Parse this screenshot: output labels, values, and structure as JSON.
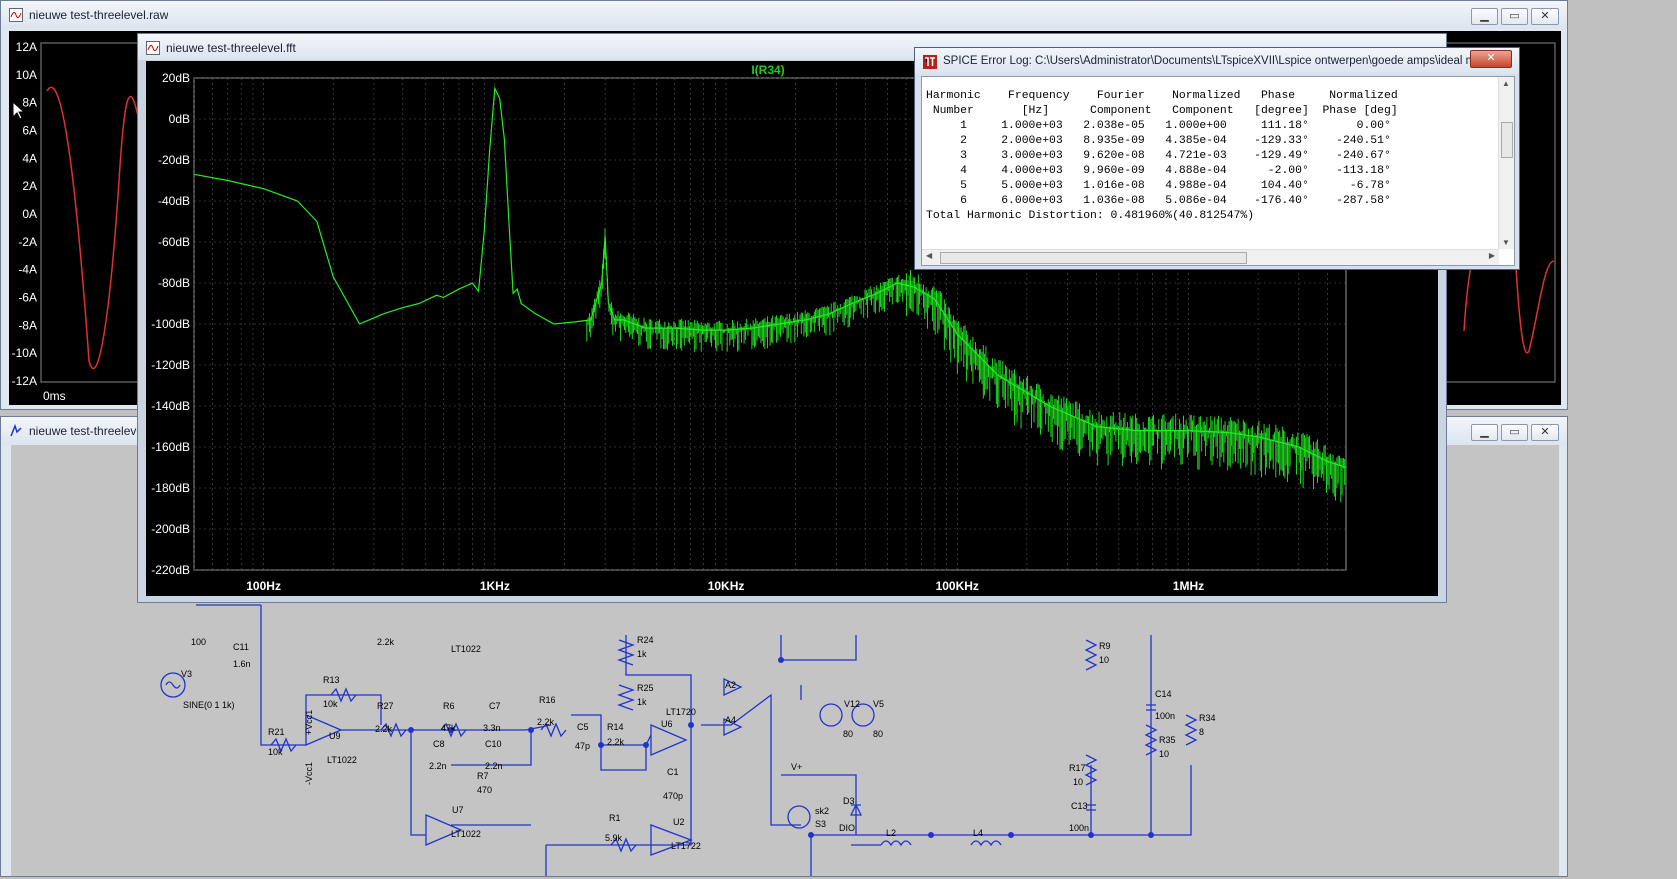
{
  "raw_window": {
    "title": "nieuwe test-threelevel.raw",
    "y_ticks": [
      "12A",
      "10A",
      "8A",
      "6A",
      "4A",
      "2A",
      "0A",
      "-2A",
      "-4A",
      "-6A",
      "-8A",
      "-10A",
      "-12A"
    ],
    "x_first_tick": "0ms",
    "trace_color": "#e03030"
  },
  "schematic_window": {
    "title": "nieuwe test-threelevel",
    "wire_color": "#2233cc",
    "labels": [
      {
        "name": "r-label",
        "t": "100"
      },
      {
        "name": "c11",
        "t": "C11"
      },
      {
        "name": "c11-val",
        "t": "1.6n"
      },
      {
        "name": "v3",
        "t": "V3"
      },
      {
        "name": "sine",
        "t": "SINE(0 1 1k)"
      },
      {
        "name": "r13",
        "t": "R13"
      },
      {
        "name": "r13-val",
        "t": "10k"
      },
      {
        "name": "r21",
        "t": "R21"
      },
      {
        "name": "r21-val",
        "t": "10k"
      },
      {
        "name": "u9",
        "t": "U9"
      },
      {
        "name": "lt1022-a",
        "t": "LT1022"
      },
      {
        "name": "vcc-a",
        "t": "+Vcc1"
      },
      {
        "name": "vcc-b",
        "t": "-Vcc1"
      },
      {
        "name": "r27",
        "t": "R27"
      },
      {
        "name": "r27-val",
        "t": "2.2k"
      },
      {
        "name": "r-22k-top",
        "t": "2.2k"
      },
      {
        "name": "lt1022-b",
        "t": "LT1022"
      },
      {
        "name": "r6",
        "t": "R6"
      },
      {
        "name": "r6-val",
        "t": "47k"
      },
      {
        "name": "c7",
        "t": "C7"
      },
      {
        "name": "c7-val",
        "t": "3.3n"
      },
      {
        "name": "c8",
        "t": "C8"
      },
      {
        "name": "c8-val",
        "t": "2.2n"
      },
      {
        "name": "c10",
        "t": "C10"
      },
      {
        "name": "c10-val",
        "t": "2.2n"
      },
      {
        "name": "r7",
        "t": "R7"
      },
      {
        "name": "r7-val",
        "t": "470"
      },
      {
        "name": "u7",
        "t": "U7"
      },
      {
        "name": "lt1022-c",
        "t": "LT1022"
      },
      {
        "name": "r16",
        "t": "R16"
      },
      {
        "name": "r16-val",
        "t": "2.2k"
      },
      {
        "name": "c5",
        "t": "C5"
      },
      {
        "name": "c5-val",
        "t": "47p"
      },
      {
        "name": "r14",
        "t": "R14"
      },
      {
        "name": "r14-val",
        "t": "2.2k"
      },
      {
        "name": "r24",
        "t": "R24"
      },
      {
        "name": "r24-val",
        "t": "1k"
      },
      {
        "name": "r25",
        "t": "R25"
      },
      {
        "name": "r25-val",
        "t": "1k"
      },
      {
        "name": "u6",
        "t": "U6"
      },
      {
        "name": "lt1720",
        "t": "LT1720"
      },
      {
        "name": "c1",
        "t": "C1"
      },
      {
        "name": "c1-val",
        "t": "470p"
      },
      {
        "name": "r1",
        "t": "R1"
      },
      {
        "name": "r1-val",
        "t": "5.9k"
      },
      {
        "name": "u2",
        "t": "U2"
      },
      {
        "name": "lt1722",
        "t": "LT1722"
      },
      {
        "name": "a2",
        "t": "A2"
      },
      {
        "name": "a4",
        "t": "A4"
      },
      {
        "name": "vplus",
        "t": "V+"
      },
      {
        "name": "sk2",
        "t": "sk2"
      },
      {
        "name": "s3",
        "t": "S3"
      },
      {
        "name": "d3",
        "t": "D3"
      },
      {
        "name": "dio",
        "t": "DIO"
      },
      {
        "name": "l2",
        "t": "L2"
      },
      {
        "name": "l4",
        "t": "L4"
      },
      {
        "name": "v12",
        "t": "V12"
      },
      {
        "name": "v12-val",
        "t": "80"
      },
      {
        "name": "v5",
        "t": "V5"
      },
      {
        "name": "v5-val",
        "t": "80"
      },
      {
        "name": "r9",
        "t": "R9"
      },
      {
        "name": "r9-val",
        "t": "10"
      },
      {
        "name": "c14",
        "t": "C14"
      },
      {
        "name": "c14-val",
        "t": "100n"
      },
      {
        "name": "r35",
        "t": "R35"
      },
      {
        "name": "r35-val",
        "t": "10"
      },
      {
        "name": "r34",
        "t": "R34"
      },
      {
        "name": "r34-val",
        "t": "8"
      },
      {
        "name": "r17",
        "t": "R17"
      },
      {
        "name": "r17-val",
        "t": "10"
      },
      {
        "name": "c13",
        "t": "C13"
      },
      {
        "name": "c13-val",
        "t": "100n"
      }
    ]
  },
  "fft_window": {
    "title": "nieuwe test-threelevel.fft",
    "trace_label": "I(R34)",
    "trace_color": "#22ee22",
    "label_color": "#22cc22"
  },
  "chart_data": {
    "type": "line",
    "title": "I(R34)",
    "xscale": "log",
    "xlim": [
      50,
      4800000
    ],
    "ylim": [
      -220,
      20
    ],
    "x_ticks": [
      {
        "v": 100,
        "label": "100Hz"
      },
      {
        "v": 1000,
        "label": "1KHz"
      },
      {
        "v": 10000,
        "label": "10KHz"
      },
      {
        "v": 100000,
        "label": "100KHz"
      },
      {
        "v": 1000000,
        "label": "1MHz"
      }
    ],
    "y_ticks": [
      {
        "v": 20,
        "label": "20dB"
      },
      {
        "v": 0,
        "label": "0dB"
      },
      {
        "v": -20,
        "label": "-20dB"
      },
      {
        "v": -40,
        "label": "-40dB"
      },
      {
        "v": -60,
        "label": "-60dB"
      },
      {
        "v": -80,
        "label": "-80dB"
      },
      {
        "v": -100,
        "label": "-100dB"
      },
      {
        "v": -120,
        "label": "-120dB"
      },
      {
        "v": -140,
        "label": "-140dB"
      },
      {
        "v": -160,
        "label": "-160dB"
      },
      {
        "v": -180,
        "label": "-180dB"
      },
      {
        "v": -200,
        "label": "-200dB"
      },
      {
        "v": -220,
        "label": "-220dB"
      }
    ],
    "grid": true,
    "series": [
      {
        "name": "I(R34)",
        "x": [
          50,
          70,
          100,
          140,
          170,
          200,
          260,
          330,
          400,
          470,
          560,
          600,
          700,
          800,
          850,
          900,
          950,
          1000,
          1050,
          1100,
          1150,
          1200,
          1250,
          1300,
          1500,
          1800,
          2200,
          2600,
          2900,
          3000,
          3100,
          3300,
          3600,
          4500,
          6000,
          8000,
          10000,
          13000,
          17000,
          22000,
          28000,
          35000,
          45000,
          55000,
          65000,
          80000,
          100000,
          150000,
          250000,
          400000,
          600000,
          1000000,
          1500000,
          2000000,
          3000000,
          4000000,
          4800000
        ],
        "y": [
          -27,
          -30,
          -34,
          -40,
          -50,
          -77,
          -100,
          -95,
          -92,
          -90,
          -86,
          -87,
          -83,
          -80,
          -84,
          -55,
          -15,
          15,
          10,
          -10,
          -50,
          -85,
          -83,
          -90,
          -95,
          -100,
          -99,
          -98,
          -80,
          -57,
          -90,
          -98,
          -98,
          -102,
          -102,
          -103,
          -103,
          -102,
          -100,
          -98,
          -95,
          -90,
          -85,
          -80,
          -82,
          -88,
          -105,
          -125,
          -140,
          -150,
          -152,
          -152,
          -153,
          -155,
          -160,
          -167,
          -170
        ]
      }
    ]
  },
  "error_log": {
    "title": "SPICE Error Log: C:\\Users\\Administrator\\Documents\\LTspiceXVII\\Lspice ontwerpen\\goede amps\\ideal mo...",
    "headers1": [
      "Harmonic",
      "Frequency",
      "Fourier",
      "Normalized",
      "Phase",
      "Normalized"
    ],
    "headers2": [
      "Number",
      "[Hz]",
      "Component",
      "Component",
      "[degree]",
      "Phase [deg]"
    ],
    "rows": [
      [
        "1",
        "1.000e+03",
        "2.038e-05",
        "1.000e+00",
        "111.18°",
        "0.00°"
      ],
      [
        "2",
        "2.000e+03",
        "8.935e-09",
        "4.385e-04",
        "-129.33°",
        "-240.51°"
      ],
      [
        "3",
        "3.000e+03",
        "9.620e-08",
        "4.721e-03",
        "-129.49°",
        "-240.67°"
      ],
      [
        "4",
        "4.000e+03",
        "9.960e-09",
        "4.888e-04",
        "-2.00°",
        "-113.18°"
      ],
      [
        "5",
        "5.000e+03",
        "1.016e-08",
        "4.988e-04",
        "104.40°",
        "-6.78°"
      ],
      [
        "6",
        "6.000e+03",
        "1.036e-08",
        "5.086e-04",
        "-176.40°",
        "-287.58°"
      ]
    ],
    "thd": "Total Harmonic Distortion: 0.481960%(40.812547%)"
  },
  "window_controls": {
    "min": "▁",
    "max": "▭",
    "close": "✕"
  }
}
